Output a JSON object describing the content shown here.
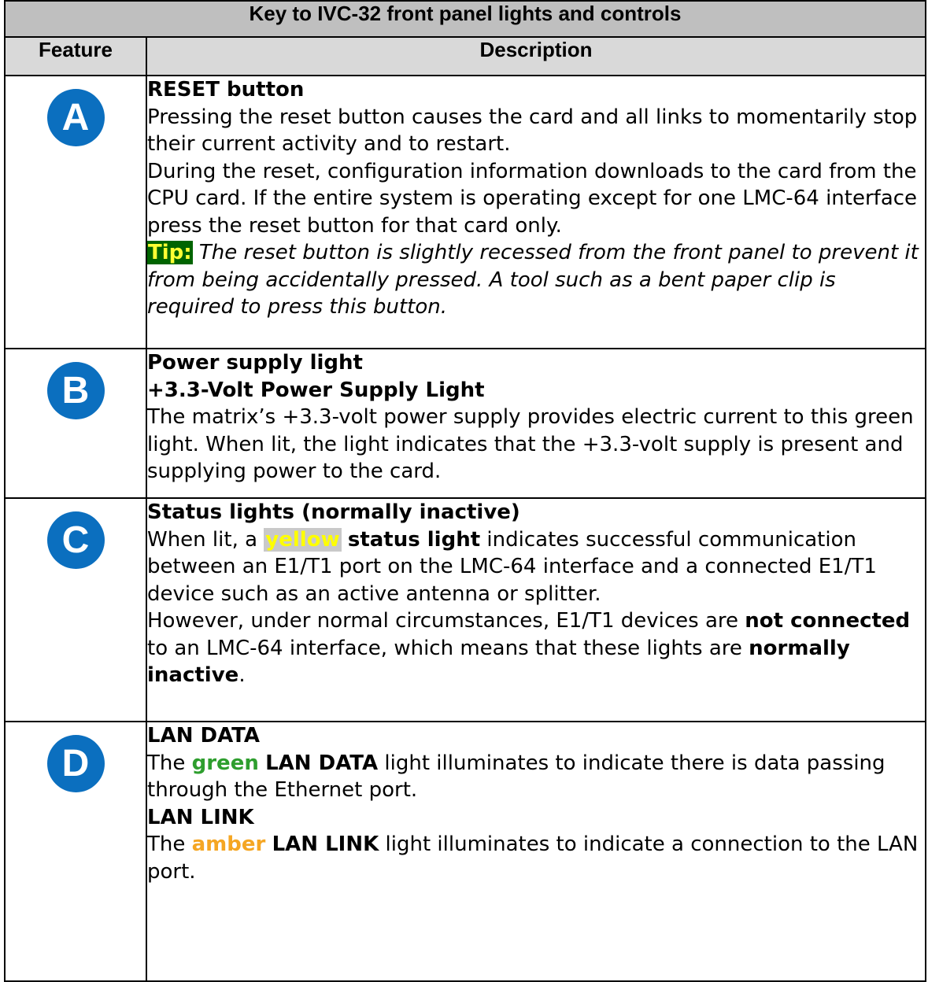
{
  "title": "Key to IVC-32 front panel lights and controls",
  "headers": {
    "feature": "Feature",
    "description": "Description"
  },
  "rows": [
    {
      "letter": "A",
      "heading": "RESET button",
      "p1": "Pressing the reset button causes the card and all links to momentarily stop their current activity and to restart.",
      "p2": "During the reset, configuration information downloads to the card from the CPU card. If the entire system is operating except for one LMC-64 interface press the reset button for that card only.",
      "tip_label": "Tip:",
      "tip_text": "The reset button is slightly recessed from the front panel to prevent it from being accidentally pressed. A tool such as a bent paper clip is required to press this button."
    },
    {
      "letter": "B",
      "heading": "Power supply light",
      "subheading": "+3.3-Volt Power Supply Light",
      "p1": "The matrix’s +3.3-volt power supply provides electric current to this green light. When lit, the light indicates that the +3.3-volt supply is present and supplying power to the card."
    },
    {
      "letter": "C",
      "heading": "Status lights (normally inactive)",
      "p1_pre": "When lit, a ",
      "p1_color": "yellow",
      "p1_bold": "status light",
      "p1_post": " indicates successful communication between an E1/T1 port on the LMC-64 interface and a connected E1/T1 device such as an active antenna or splitter.",
      "p2_pre": "However, under normal circumstances, E1/T1 devices are ",
      "p2_bold1": "not connected",
      "p2_mid": " to an LMC-64 interface, which means that these lights are ",
      "p2_bold2": "normally inactive",
      "p2_post": "."
    },
    {
      "letter": "D",
      "heading1": "LAN DATA",
      "p1_pre": "The ",
      "p1_color": "green",
      "p1_bold": "LAN DATA",
      "p1_post": " light illuminates to indicate there is data passing through the Ethernet port.",
      "heading2": "LAN LINK",
      "p2_pre": "The ",
      "p2_color": "amber",
      "p2_bold": "LAN LINK",
      "p2_post": " light illuminates to indicate a connection to the LAN port."
    }
  ],
  "colors": {
    "badge": "#0b6fbf",
    "title_bg": "#bfbfbf",
    "header_bg": "#d9d9d9",
    "tip_bg": "#006400",
    "green_text": "#2e9e2e",
    "amber_text": "#f5a623"
  }
}
